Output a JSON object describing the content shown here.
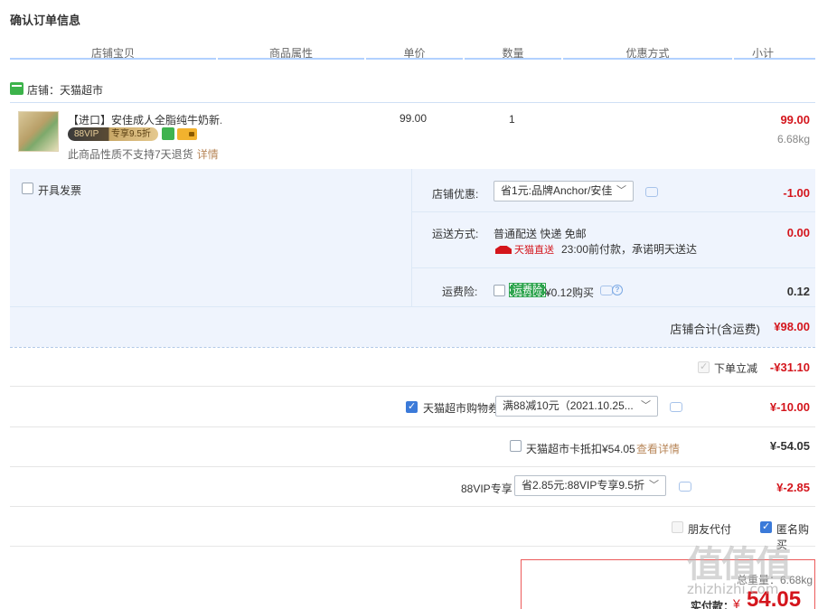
{
  "page_title": "确认订单信息",
  "columns": [
    "店铺宝贝",
    "商品属性",
    "单价",
    "数量",
    "优惠方式",
    "小计"
  ],
  "shop": {
    "label": "店铺：天猫超市"
  },
  "product": {
    "title": "【进口】安佳成人全脂纯牛奶新...",
    "vip_badge_left": "88VIP",
    "vip_badge_right": "专享9.5折",
    "return_note": "此商品性质不支持7天退货",
    "detail_link": "详情",
    "unit_price": "99.00",
    "quantity": "1",
    "subtotal": "99.00",
    "weight": "6.68kg"
  },
  "invoice": {
    "label": "开具发票"
  },
  "shop_discount": {
    "label": "店铺优惠:",
    "select_value": "省1元:品牌Anchor/安佳",
    "amount": "-1.00"
  },
  "shipping": {
    "label": "运送方式:",
    "method": "普通配送 快递 免邮",
    "tmall_direct": "天猫直送",
    "promise": "23:00前付款，承诺明天送达",
    "amount": "0.00"
  },
  "freight_insurance": {
    "label": "运费险:",
    "tag": "运费险",
    "price_text": "¥0.12购买",
    "amount": "0.12"
  },
  "shop_total": {
    "label": "店铺合计(含运费)",
    "amount": "¥98.00"
  },
  "instant_discount": {
    "label": "下单立减",
    "amount": "-¥31.10"
  },
  "coupon": {
    "label": "天猫超市购物券",
    "select_value": "满88减10元（2021.10.25...",
    "amount": "¥-10.00"
  },
  "card_deduct": {
    "label": "天猫超市卡抵扣¥54.05",
    "link": "查看详情",
    "amount": "¥-54.05"
  },
  "vip_discount": {
    "label": "88VIP专享",
    "select_value": "省2.85元:88VIP专享9.5折",
    "amount": "¥-2.85"
  },
  "friend_pay": {
    "label": "朋友代付"
  },
  "anonymous": {
    "label": "匿名购买"
  },
  "payment": {
    "weight_text": "总重量：6.68kg",
    "label": "实付款：",
    "currency": "¥",
    "amount": "54.05"
  },
  "watermark": {
    "big": "值值值",
    "small": "zhizhizhi.com"
  },
  "colors": {
    "accent_red": "#d4151c",
    "header_line": "#b2d1ff",
    "panel_bg": "#eff4fd",
    "check_blue": "#3b7ad9"
  }
}
